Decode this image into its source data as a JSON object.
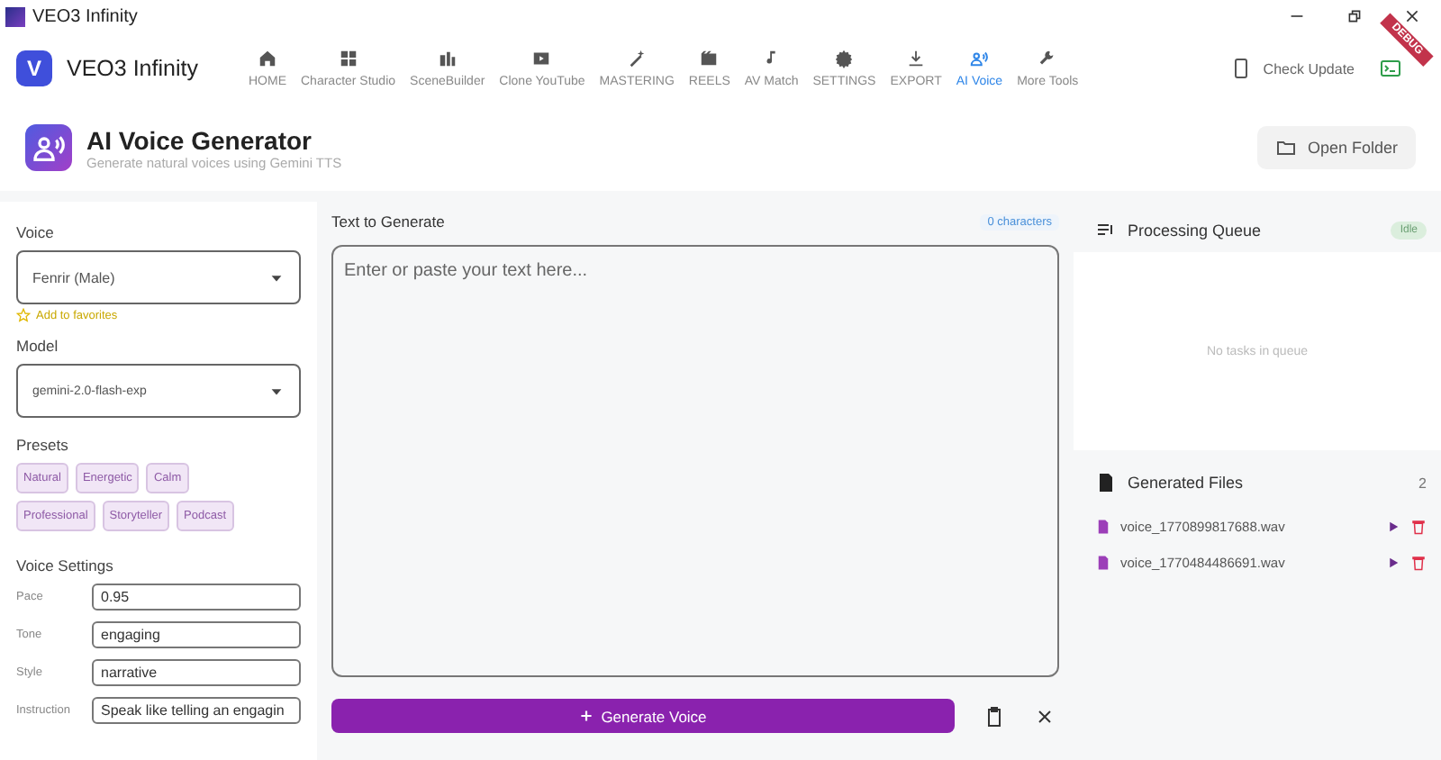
{
  "window": {
    "title": "VEO3 Infinity"
  },
  "app": {
    "logo_letter": "V",
    "name": "VEO3 Infinity",
    "ribbon": "DEBUG"
  },
  "nav": [
    {
      "label": "HOME",
      "selected": false
    },
    {
      "label": "Character Studio",
      "selected": false
    },
    {
      "label": "SceneBuilder",
      "selected": false
    },
    {
      "label": "Clone YouTube",
      "selected": false
    },
    {
      "label": "MASTERING",
      "selected": false
    },
    {
      "label": "REELS",
      "selected": false
    },
    {
      "label": "AV Match",
      "selected": false
    },
    {
      "label": "SETTINGS",
      "selected": false
    },
    {
      "label": "EXPORT",
      "selected": false
    },
    {
      "label": "AI Voice",
      "selected": true
    },
    {
      "label": "More Tools",
      "selected": false
    }
  ],
  "check_update": "Check Update",
  "page": {
    "title": "AI Voice Generator",
    "subtitle": "Generate natural voices using Gemini TTS",
    "open_folder": "Open Folder"
  },
  "left": {
    "voice_label": "Voice",
    "voice": "Fenrir (Male)",
    "favorite": "Add to favorites",
    "model_label": "Model",
    "model": "gemini-2.0-flash-exp",
    "presets_label": "Presets",
    "presets": [
      [
        "Natural",
        "Energetic",
        "Calm"
      ],
      [
        "Professional",
        "Storyteller",
        "Podcast"
      ]
    ],
    "settings_label": "Voice Settings",
    "settings": [
      {
        "label": "Pace",
        "value": "0.95"
      },
      {
        "label": "Tone",
        "value": "engaging"
      },
      {
        "label": "Style",
        "value": "narrative"
      },
      {
        "label": "Instruction",
        "value": "Speak like telling an engagin"
      }
    ]
  },
  "center": {
    "label": "Text to Generate",
    "count": "0 characters",
    "placeholder": "Enter or paste your text here...",
    "generate": "Generate Voice"
  },
  "queue": {
    "title": "Processing Queue",
    "status": "Idle",
    "empty": "No tasks in queue"
  },
  "files": {
    "title": "Generated Files",
    "count": "2",
    "items": [
      "voice_1770899817688.wav",
      "voice_1770484486691.wav"
    ]
  }
}
